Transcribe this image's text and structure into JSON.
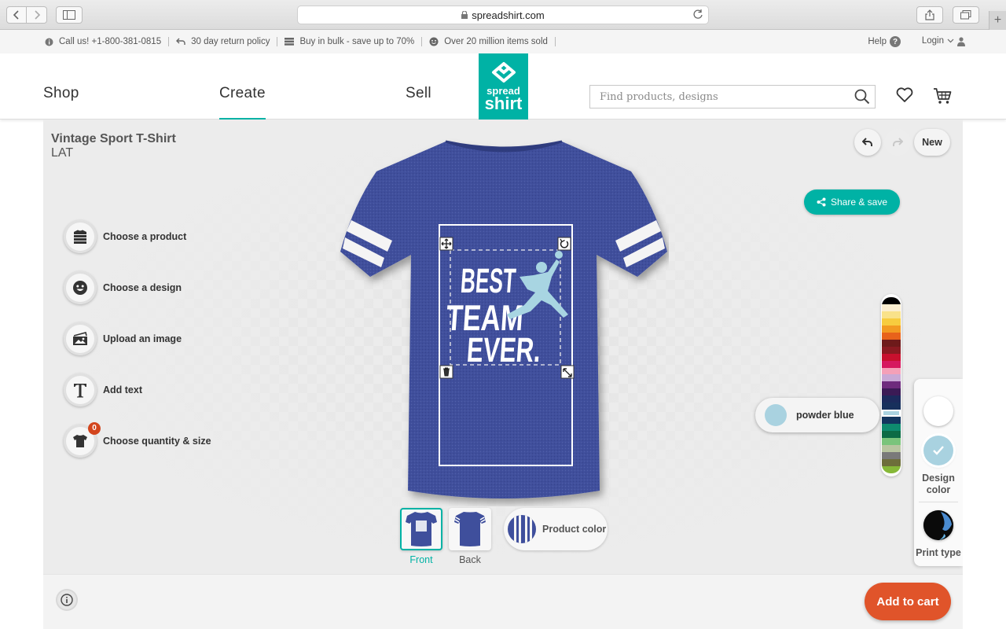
{
  "browser": {
    "url": "spreadshirt.com"
  },
  "infobar": {
    "call": "Call us! +1-800-381-0815",
    "returns": "30 day return policy",
    "bulk": "Buy in bulk - save up to 70%",
    "sold": "Over 20 million items sold",
    "help": "Help",
    "help_q": "?",
    "login": "Login"
  },
  "header": {
    "nav": [
      "Shop",
      "Create",
      "Sell"
    ],
    "logo_top": "spread",
    "logo_bottom": "shirt",
    "search_placeholder": "Find products, designs",
    "brand_color": "#00b2a5"
  },
  "product": {
    "title": "Vintage Sport T-Shirt",
    "subtitle": "LAT",
    "shirt_color": "#3f4f9c"
  },
  "tools": [
    {
      "label": "Choose a product",
      "icon": "shirt-stack-icon"
    },
    {
      "label": "Choose a design",
      "icon": "smiley-icon"
    },
    {
      "label": "Upload an image",
      "icon": "upload-image-icon"
    },
    {
      "label": "Add text",
      "icon": "text-icon"
    },
    {
      "label": "Choose quantity & size",
      "icon": "shirt-size-icon",
      "badge": "0"
    }
  ],
  "actions": {
    "new": "New",
    "share_save": "Share & save",
    "add_to_cart": "Add to cart"
  },
  "design": {
    "lines": [
      "BEST",
      "TEAM",
      "EVER."
    ],
    "color": "#a8d5e2"
  },
  "views": [
    {
      "label": "Front",
      "selected": true
    },
    {
      "label": "Back",
      "selected": false
    }
  ],
  "product_color_label": "Product color",
  "selected_color": {
    "name": "powder blue",
    "hex": "#a9d2e0"
  },
  "right_panel": {
    "design_color_label": "Design color",
    "print_type_label": "Print type"
  },
  "palette": [
    "#000000",
    "#fbeed0",
    "#f9e28a",
    "#f7cc3f",
    "#f29a22",
    "#e8621b",
    "#6e1a1a",
    "#8a1a21",
    "#c8102e",
    "#d6185f",
    "#f4a0b8",
    "#c9a9d6",
    "#6e2b7d",
    "#3b1a55",
    "#1c2a5c",
    "#17305c",
    "#a9d2e0",
    "#12355e",
    "#0e8a6e",
    "#0c6b45",
    "#7ac47b",
    "#b8c5a0",
    "#7a7a7a",
    "#6d6e3a",
    "#86b838"
  ]
}
